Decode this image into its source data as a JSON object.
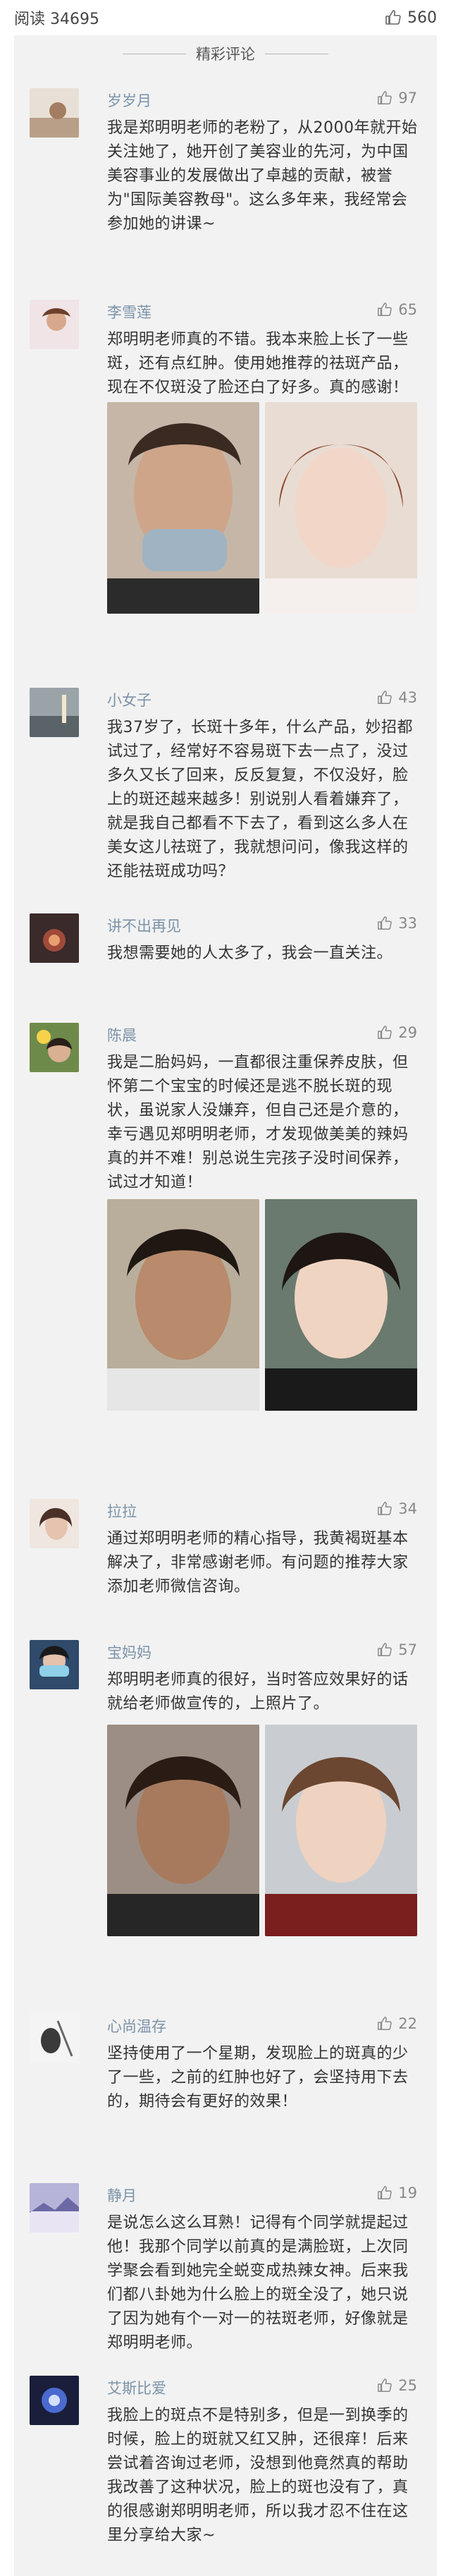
{
  "header": {
    "read_label": "阅读 34695",
    "like_count": "560"
  },
  "section_title": "精彩评论",
  "comments": [
    {
      "name": "岁岁月",
      "likes": "97",
      "text": "我是郑明明老师的老粉了，从2000年就开始关注她了，她开创了美容业的先河，为中国美容事业的发展做出了卓越的贡献，被誉为\"国际美容教母\"。这么多年来，我经常会参加她的讲课~"
    },
    {
      "name": "李雪莲",
      "likes": "65",
      "text": "郑明明老师真的不错。我本来脸上长了一些斑，还有点红肿。使用她推荐的祛斑产品，现在不仅斑没了脸还白了好多。真的感谢！"
    },
    {
      "name": "小女子",
      "likes": "43",
      "text": "我37岁了，长斑十多年，什么产品，妙招都试过了，经常好不容易斑下去一点了，没过多久又长了回来，反反复复，不仅没好，脸上的斑还越来越多！别说别人看着嫌弃了，就是我自己都看不下去了，看到这么多人在美女这儿祛斑了，我就想问问，像我这样的还能祛斑成功吗？"
    },
    {
      "name": "讲不出再见",
      "likes": "33",
      "text": "我想需要她的人太多了，我会一直关注。"
    },
    {
      "name": "陈晨",
      "likes": "29",
      "text": "我是二胎妈妈，一直都很注重保养皮肤，但怀第二个宝宝的时候还是逃不脱长斑的现状，虽说家人没嫌弃，但自己还是介意的，幸亏遇见郑明明老师，才发现做美美的辣妈真的并不难！别总说生完孩子没时间保养，试过才知道！"
    },
    {
      "name": "拉拉",
      "likes": "34",
      "text": "通过郑明明老师的精心指导，我黄褐斑基本解决了，非常感谢老师。有问题的推荐大家添加老师微信咨询。"
    },
    {
      "name": "宝妈妈",
      "likes": "57",
      "text": "郑明明老师真的很好，当时答应效果好的话就给老师做宣传的，上照片了。"
    },
    {
      "name": "心尚温存",
      "likes": "22",
      "text": "坚持使用了一个星期，发现脸上的斑真的少了一些，之前的红肿也好了，会坚持用下去的，期待会有更好的效果！"
    },
    {
      "name": "静月",
      "likes": "19",
      "text": "是说怎么这么耳熟！记得有个同学就提起过他！我那个同学以前真的是满脸斑，上次同学聚会看到她完全蜕变成热辣女神。后来我们都八卦她为什么脸上的斑全没了，她只说了因为她有个一对一的祛斑老师，好像就是郑明明老师。"
    },
    {
      "name": "艾斯比爱",
      "likes": "25",
      "text": "我脸上的斑点不是特别多，但是一到换季的时候，脸上的斑就又红又肿，还很痒！后来尝试着咨询过老师，没想到他竟然真的帮助我改善了这种状况，脸上的斑也没有了，真的很感谢郑明明老师，所以我才忍不住在这里分享给大家~"
    }
  ],
  "colors": {
    "name": "#7b93a8",
    "panel_bg": "#f2f2f2",
    "text": "#333333"
  },
  "icons": {
    "like": "thumbs-up-icon"
  }
}
